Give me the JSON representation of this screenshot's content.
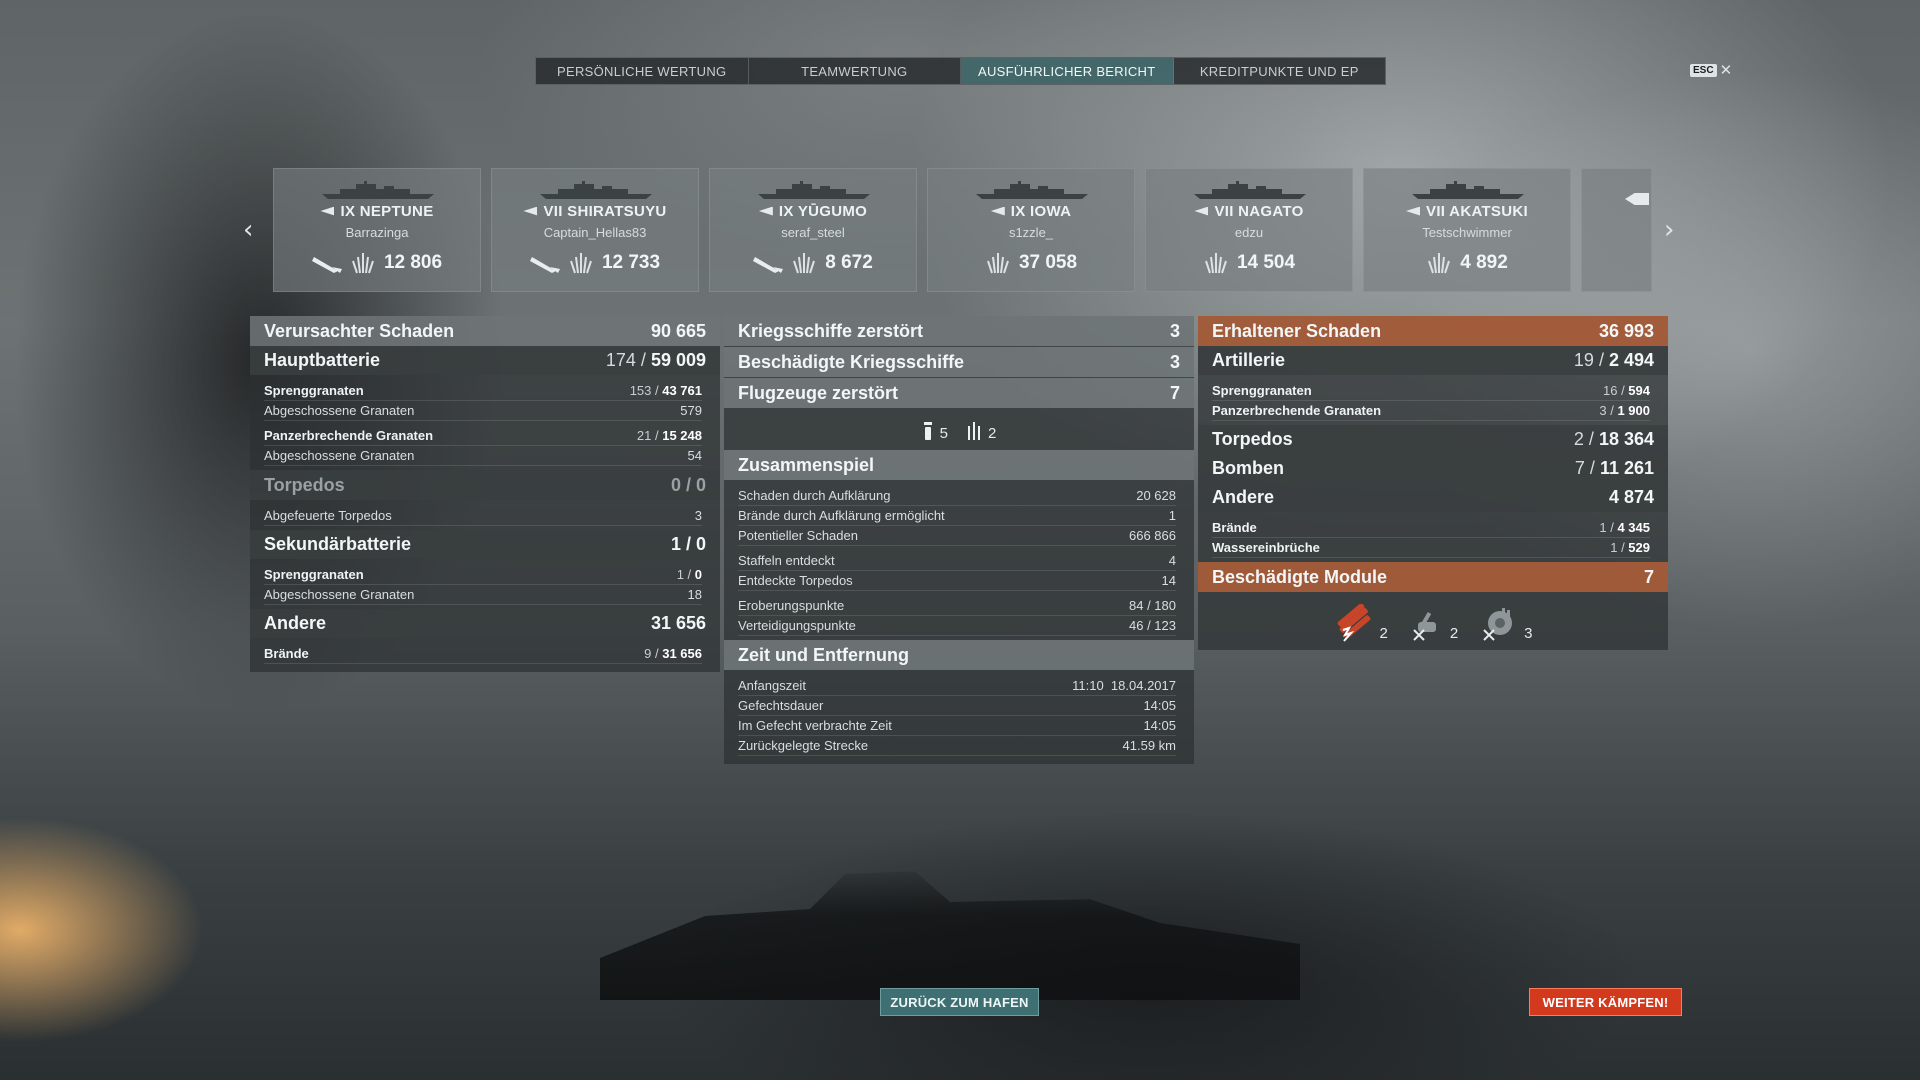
{
  "tabs": [
    {
      "label": "PERSÖNLICHE WERTUNG",
      "active": false
    },
    {
      "label": "TEAMWERTUNG",
      "active": false
    },
    {
      "label": "AUSFÜHRLICHER BERICHT",
      "active": true
    },
    {
      "label": "KREDITPUNKTE UND EP",
      "active": false
    }
  ],
  "esc": {
    "key": "ESC",
    "close": "✕"
  },
  "nav": {
    "prev": "‹",
    "next": "›"
  },
  "cards": [
    {
      "ship": "IX NEPTUNE",
      "player": "Barrazinga",
      "damage": "12 806",
      "plane": true,
      "class_icon": "cruiser-icon"
    },
    {
      "ship": "VII SHIRATSUYU",
      "player": "Captain_Hellas83",
      "damage": "12 733",
      "plane": true,
      "class_icon": "destroyer-icon"
    },
    {
      "ship": "IX YŪGUMO",
      "player": "seraf_steel",
      "damage": "8 672",
      "plane": true,
      "class_icon": "destroyer-icon"
    },
    {
      "ship": "IX IOWA",
      "player": "s1zzle_",
      "damage": "37 058",
      "plane": false,
      "class_icon": "battleship-icon"
    },
    {
      "ship": "VII NAGATO",
      "player": "edzu",
      "damage": "14 504",
      "plane": false,
      "class_icon": "battleship-icon"
    },
    {
      "ship": "VII AKATSUKI",
      "player": "Testschwimmer",
      "damage": "4 892",
      "plane": false,
      "class_icon": "destroyer-icon"
    }
  ],
  "left": {
    "caused": {
      "label": "Verursachter Schaden",
      "value": "90 665"
    },
    "main": {
      "label": "Hauptbatterie",
      "hits": "174",
      "dmg": "59 009"
    },
    "he": {
      "label": "Sprenggranaten",
      "hits": "153",
      "dmg": "43 761"
    },
    "he_fired": {
      "label": "Abgeschossene Granaten",
      "value": "579"
    },
    "ap": {
      "label": "Panzerbrechende Granaten",
      "hits": "21",
      "dmg": "15 248"
    },
    "ap_fired": {
      "label": "Abgeschossene Granaten",
      "value": "54"
    },
    "torp": {
      "label": "Torpedos",
      "value": "0 / 0"
    },
    "torp_fired": {
      "label": "Abgefeuerte Torpedos",
      "value": "3"
    },
    "secondary": {
      "label": "Sekundärbatterie",
      "value": "1 / 0"
    },
    "sec_he": {
      "label": "Sprenggranaten",
      "hits": "1",
      "dmg": "0"
    },
    "sec_fired": {
      "label": "Abgeschossene Granaten",
      "value": "18"
    },
    "other": {
      "label": "Andere",
      "value": "31 656"
    },
    "fires": {
      "label": "Brände",
      "hits": "9",
      "dmg": "31 656"
    }
  },
  "mid": {
    "ships_destroyed": {
      "label": "Kriegsschiffe zerstört",
      "value": "3"
    },
    "ships_damaged": {
      "label": "Beschädigte Kriegsschiffe",
      "value": "3"
    },
    "planes_destroyed": {
      "label": "Flugzeuge zerstört",
      "value": "7"
    },
    "plane_types": [
      {
        "icon": "bomber-icon",
        "count": "5"
      },
      {
        "icon": "fighter-icon",
        "count": "2"
      }
    ],
    "teamplay": {
      "label": "Zusammenspiel"
    },
    "spot_dmg": {
      "label": "Schaden durch Aufklärung",
      "value": "20 628"
    },
    "spot_fires": {
      "label": "Brände durch Aufklärung ermöglicht",
      "value": "1"
    },
    "potential": {
      "label": "Potentieller Schaden",
      "value": "666 866"
    },
    "squadrons": {
      "label": "Staffeln entdeckt",
      "value": "4"
    },
    "torps_spotted": {
      "label": "Entdeckte Torpedos",
      "value": "14"
    },
    "capture": {
      "label": "Eroberungspunkte",
      "value": "84 / 180"
    },
    "defense": {
      "label": "Verteidigungspunkte",
      "value": "46 / 123"
    },
    "time": {
      "label": "Zeit und Entfernung"
    },
    "start": {
      "label": "Anfangszeit",
      "value": "11:10  18.04.2017"
    },
    "duration": {
      "label": "Gefechtsdauer",
      "value": "14:05"
    },
    "in_battle": {
      "label": "Im Gefecht verbrachte Zeit",
      "value": "14:05"
    },
    "distance": {
      "label": "Zurückgelegte Strecke",
      "value": "41.59 km"
    }
  },
  "right": {
    "received": {
      "label": "Erhaltener Schaden",
      "value": "36 993"
    },
    "artillery": {
      "label": "Artillerie",
      "hits": "19",
      "dmg": "2 494"
    },
    "he": {
      "label": "Sprenggranaten",
      "hits": "16",
      "dmg": "594"
    },
    "ap": {
      "label": "Panzerbrechende Granaten",
      "hits": "3",
      "dmg": "1 900"
    },
    "torp": {
      "label": "Torpedos",
      "hits": "2",
      "dmg": "18 364"
    },
    "bombs": {
      "label": "Bomben",
      "hits": "7",
      "dmg": "11 261"
    },
    "other": {
      "label": "Andere",
      "value": "4 874"
    },
    "fires": {
      "label": "Brände",
      "hits": "1",
      "dmg": "4 345"
    },
    "flooding": {
      "label": "Wassereinbrüche",
      "hits": "1",
      "dmg": "529"
    },
    "modules": {
      "label": "Beschädigte Module",
      "value": "7"
    },
    "module_icons": [
      {
        "icon": "torpedo-tube-icon",
        "count": "2",
        "color": "#d8502a"
      },
      {
        "icon": "secondary-gun-icon",
        "count": "2",
        "color": "#9aa2a6"
      },
      {
        "icon": "main-turret-icon",
        "count": "3",
        "color": "#9aa2a6"
      }
    ]
  },
  "buttons": {
    "port": "ZURÜCK ZUM HAFEN",
    "fight": "WEITER KÄMPFEN!"
  },
  "colors": {
    "accent_teal": "#3d6f73",
    "accent_orange": "#b25f38",
    "fight_red": "#d2391d"
  }
}
